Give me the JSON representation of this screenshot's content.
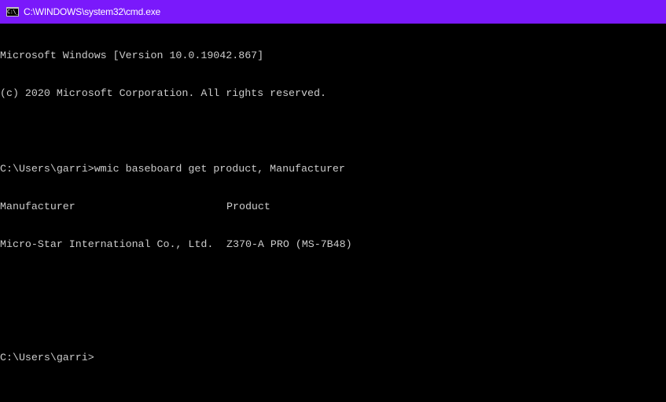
{
  "window": {
    "title": "C:\\WINDOWS\\system32\\cmd.exe",
    "icon": "cmd-icon",
    "icon_glyph": "C:\\_",
    "titlebar_color": "#7a19fb",
    "background_color": "#000000",
    "text_color": "#cccccc"
  },
  "console": {
    "banner_line1": "Microsoft Windows [Version 10.0.19042.867]",
    "banner_line2": "(c) 2020 Microsoft Corporation. All rights reserved.",
    "prompt1": "C:\\Users\\garri>",
    "command1": "wmic baseboard get product, Manufacturer",
    "output": {
      "headers": [
        "Manufacturer",
        "Product"
      ],
      "rows": [
        [
          "Micro-Star International Co., Ltd.",
          "Z370-A PRO (MS-7B48)"
        ]
      ]
    },
    "prompt2": "C:\\Users\\garri>",
    "current_input": ""
  }
}
